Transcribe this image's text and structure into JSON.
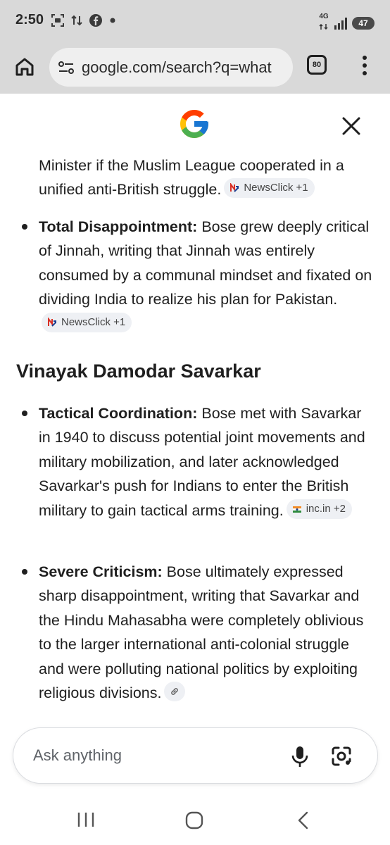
{
  "status_bar": {
    "time": "2:50",
    "network": "4G",
    "battery": "47",
    "left_icons": [
      "screen-record-icon",
      "data-transfer-icon",
      "facebook-icon",
      "dot-icon"
    ],
    "right_icons": [
      "network-type-icon",
      "signal-icon",
      "battery-icon"
    ]
  },
  "browser": {
    "url": "google.com/search?q=what",
    "tab_count": "80",
    "icons": [
      "home-icon",
      "site-settings-icon",
      "more-vert-icon"
    ]
  },
  "panel": {
    "logo": "google-g-logo",
    "close_icon": "close-icon"
  },
  "content": {
    "continuation": {
      "text": "Minister if the Muslim League cooperated in a unified anti-British struggle.",
      "chip": "NewsClick +1"
    },
    "bullets_top": [
      {
        "title": "Total Disappointment:",
        "text": " Bose grew deeply critical of Jinnah, writing that Jinnah was entirely consumed by a communal mindset and fixated on dividing India to realize his plan for Pakistan.",
        "chip": "NewsClick +1"
      }
    ],
    "section_heading": "Vinayak Damodar Savarkar",
    "bullets_bottom": [
      {
        "title": "Tactical Coordination:",
        "text": " Bose met with Savarkar in 1940 to discuss potential joint movements and military mobilization, and later acknowledged Savarkar's push for Indians to enter the British military to gain tactical arms training.",
        "chip": "inc.in +2"
      },
      {
        "title": "Severe Criticism:",
        "text": " Bose ultimately expressed sharp disappointment, writing that Savarkar and the Hindu Mahasabha were completely oblivious to the larger international anti-colonial struggle and were polluting national politics by exploiting religious divisions.",
        "chip_icon": "link-icon"
      }
    ]
  },
  "ask_bar": {
    "placeholder": "Ask anything",
    "icons": [
      "mic-icon",
      "google-lens-icon"
    ]
  },
  "nav_bar": {
    "icons": [
      "recents-icon",
      "home-nav-icon",
      "back-icon"
    ]
  },
  "colors": {
    "chrome_bg": "#d9d9d9",
    "url_pill_bg": "#efefef",
    "chip_bg": "#eef0f4",
    "text": "#1f1f1f",
    "newsclick_red": "#d93025",
    "newsclick_blue": "#1a3d8f"
  }
}
